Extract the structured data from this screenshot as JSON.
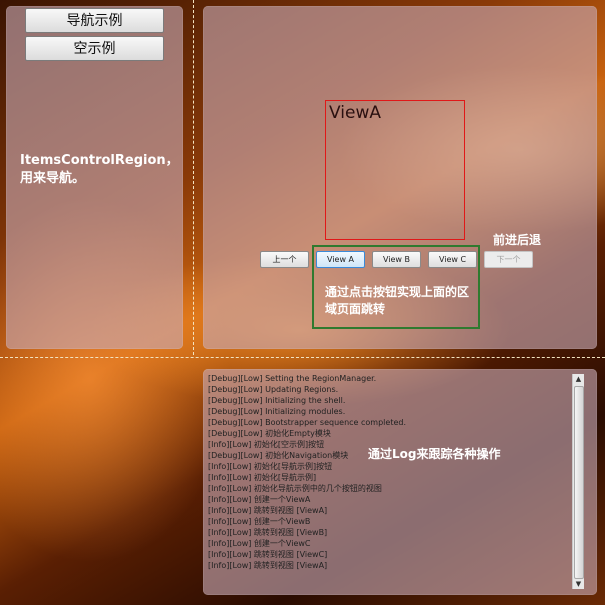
{
  "nav": {
    "buttons": [
      {
        "label": "导航示例"
      },
      {
        "label": "空示例"
      }
    ],
    "region_note": "ItemsControlRegion，用来导航。"
  },
  "view": {
    "label": "ViewA",
    "buttons": [
      {
        "label": "上一个",
        "state": "normal"
      },
      {
        "label": "View A",
        "state": "active"
      },
      {
        "label": "View B",
        "state": "normal"
      },
      {
        "label": "View C",
        "state": "normal"
      },
      {
        "label": "下一个",
        "state": "disabled"
      }
    ],
    "forward_back_note": "前进后退",
    "click_note": "通过点击按钮实现上面的区域页面跳转"
  },
  "log": {
    "entries": [
      "[Debug][Low] Setting the RegionManager.",
      "[Debug][Low] Updating Regions.",
      "[Debug][Low] Initializing the shell.",
      "[Debug][Low] Initializing modules.",
      "[Debug][Low] Bootstrapper sequence completed.",
      "[Debug][Low] 初始化Empty模块",
      "[Info][Low] 初始化[空示例]按钮",
      "[Debug][Low] 初始化Navigation模块",
      "[Info][Low] 初始化[导航示例]按钮",
      "[Info][Low] 初始化[导航示例]",
      "[Info][Low] 初始化导航示例中的几个按钮的视图",
      "[Info][Low] 创建一个ViewA",
      "[Info][Low] 跳转到视图 [ViewA]",
      "[Info][Low] 创建一个ViewB",
      "[Info][Low] 跳转到视图 [ViewB]",
      "[Info][Low] 创建一个ViewC",
      "[Info][Low] 跳转到视图 [ViewC]",
      "[Info][Low] 跳转到视图 [ViewA]"
    ],
    "note": "通过Log来跟踪各种操作"
  }
}
